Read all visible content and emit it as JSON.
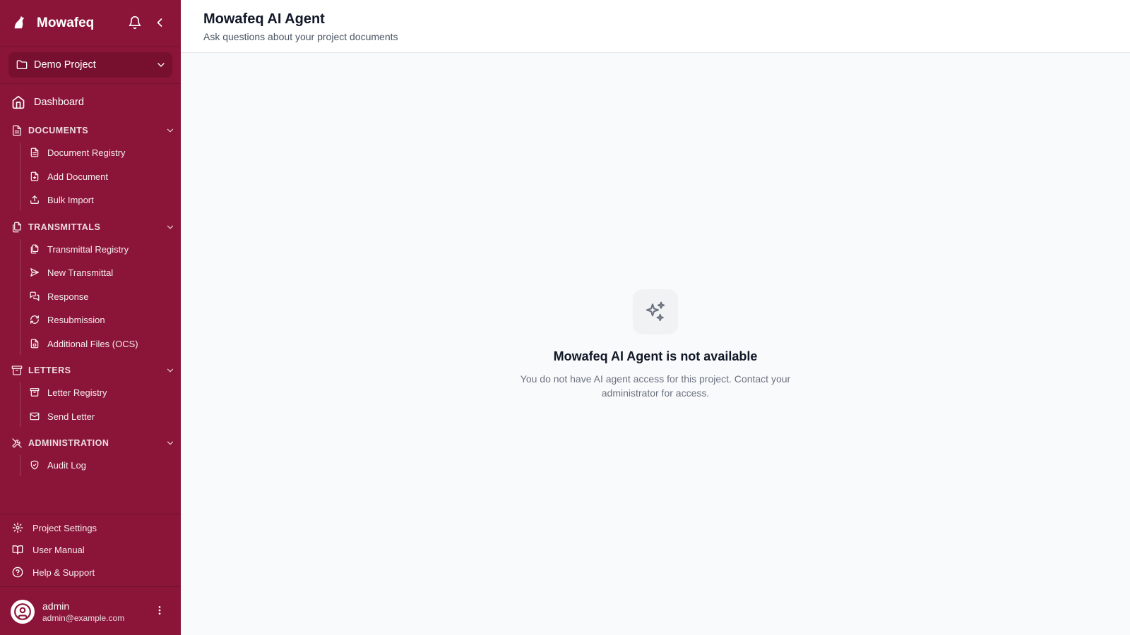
{
  "app": {
    "brand": "Mowafeq"
  },
  "project_selector": {
    "value": "Demo Project"
  },
  "nav": {
    "dashboard": "Dashboard",
    "sections": [
      {
        "label": "DOCUMENTS",
        "items": [
          "Document Registry",
          "Add Document",
          "Bulk Import"
        ]
      },
      {
        "label": "TRANSMITTALS",
        "items": [
          "Transmittal Registry",
          "New Transmittal",
          "Response",
          "Resubmission",
          "Additional Files (OCS)"
        ]
      },
      {
        "label": "LETTERS",
        "items": [
          "Letter Registry",
          "Send Letter"
        ]
      },
      {
        "label": "ADMINISTRATION",
        "items": [
          "Audit Log"
        ]
      }
    ]
  },
  "footer_nav": [
    "Project Settings",
    "User Manual",
    "Help & Support"
  ],
  "user": {
    "name": "admin",
    "email": "admin@example.com"
  },
  "header": {
    "title": "Mowafeq AI Agent",
    "subtitle": "Ask questions about your project documents"
  },
  "empty_state": {
    "icon": "sparkles-icon",
    "title": "Mowafeq AI Agent is not available",
    "description": "You do not have AI agent access for this project. Contact your administrator for access."
  },
  "colors": {
    "sidebar": "#8a1538",
    "sidebar_dark": "#77102f",
    "content_bg": "#f9fafb"
  }
}
